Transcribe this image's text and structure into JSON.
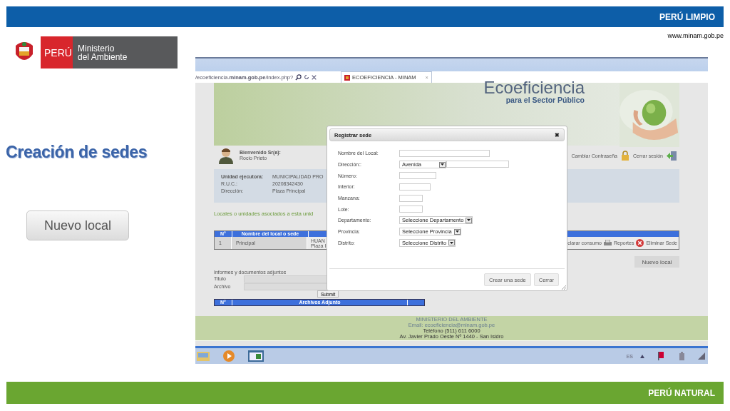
{
  "top_bar": {
    "label": "PERÚ LIMPIO"
  },
  "website": "www.minam.gob.pe",
  "logo": {
    "badge": "PERÚ",
    "name_lines": [
      "Ministerio",
      "del Ambiente"
    ]
  },
  "title": "Creación de sedes",
  "new_local_button": "Nuevo local",
  "screenshot": {
    "browser": {
      "address": "/ecoeficiencia.**minam.gob.pe**/index.php?",
      "tab": {
        "label": "ECOEFICIENCIA - MINAM",
        "close": "×",
        "selected": true
      }
    },
    "banner": {
      "title": "Ecoeficiencia",
      "subtitle": "para el Sector Público"
    },
    "user": {
      "greeting": "Bienvenido Sr(a):",
      "name": "Rocio Prieto"
    },
    "links": [
      "Cambiar Contraseña",
      "Cerrar sesión"
    ],
    "info": [
      {
        "label": "Unidad ejecutora:",
        "value": "MUNICIPALIDAD PRO"
      },
      {
        "label": "R.U.C.:",
        "value": "20208342430"
      },
      {
        "label": "Dirección:",
        "value": "Plaza Principal"
      }
    ],
    "section_heading": "Locales o unidades asociados a esta unid",
    "locales_table": {
      "columns": [
        "N°",
        "Nombre del local o sede"
      ],
      "rows": [
        {
          "cells": [
            "1",
            "Principal"
          ],
          "address_lines": [
            "HUAN",
            "Plaza I"
          ],
          "actions": [
            "clarar consumo",
            "Reportes",
            "Eliminar Sede"
          ]
        }
      ]
    },
    "new_local_button": "Nuevo local",
    "attachments": {
      "heading": "Informes y documentos adjuntos",
      "fields": [
        "Titulo",
        "Archivo"
      ],
      "submit": "Submit",
      "columns": [
        "N°",
        "Archivos Adjunto"
      ]
    },
    "footer": [
      "MINISTERIO DEL AMBIENTE",
      "Email: ecoeficiencia@minam.gob.pe",
      "Teléfono (511) 611 6000",
      "Av. Javier Prado Oeste Nº 1440 - San Isidro"
    ],
    "taskbar": {
      "language": "ES"
    },
    "dialog": {
      "title": "Registrar sede",
      "close": "✖",
      "fields": [
        {
          "label": "Nombre del Local:",
          "kind": "text"
        },
        {
          "label": "Dirección::",
          "kind": "select_text",
          "value": "Avenida"
        },
        {
          "label": "Número:",
          "kind": "text"
        },
        {
          "label": "Interior:",
          "kind": "text"
        },
        {
          "label": "Manzana:",
          "kind": "text"
        },
        {
          "label": "Lote:",
          "kind": "text"
        },
        {
          "label": "Departamento:",
          "kind": "select",
          "value": "Seleccione Departamento"
        },
        {
          "label": "Provincia:",
          "kind": "select",
          "value": "Seleccione Provincia"
        },
        {
          "label": "Distrito:",
          "kind": "select",
          "value": "Seleccione Distrito"
        }
      ],
      "buttons": [
        "Crear una sede",
        "Cerrar"
      ]
    }
  },
  "bottom_bar": {
    "label": "PERÚ NATURAL"
  }
}
